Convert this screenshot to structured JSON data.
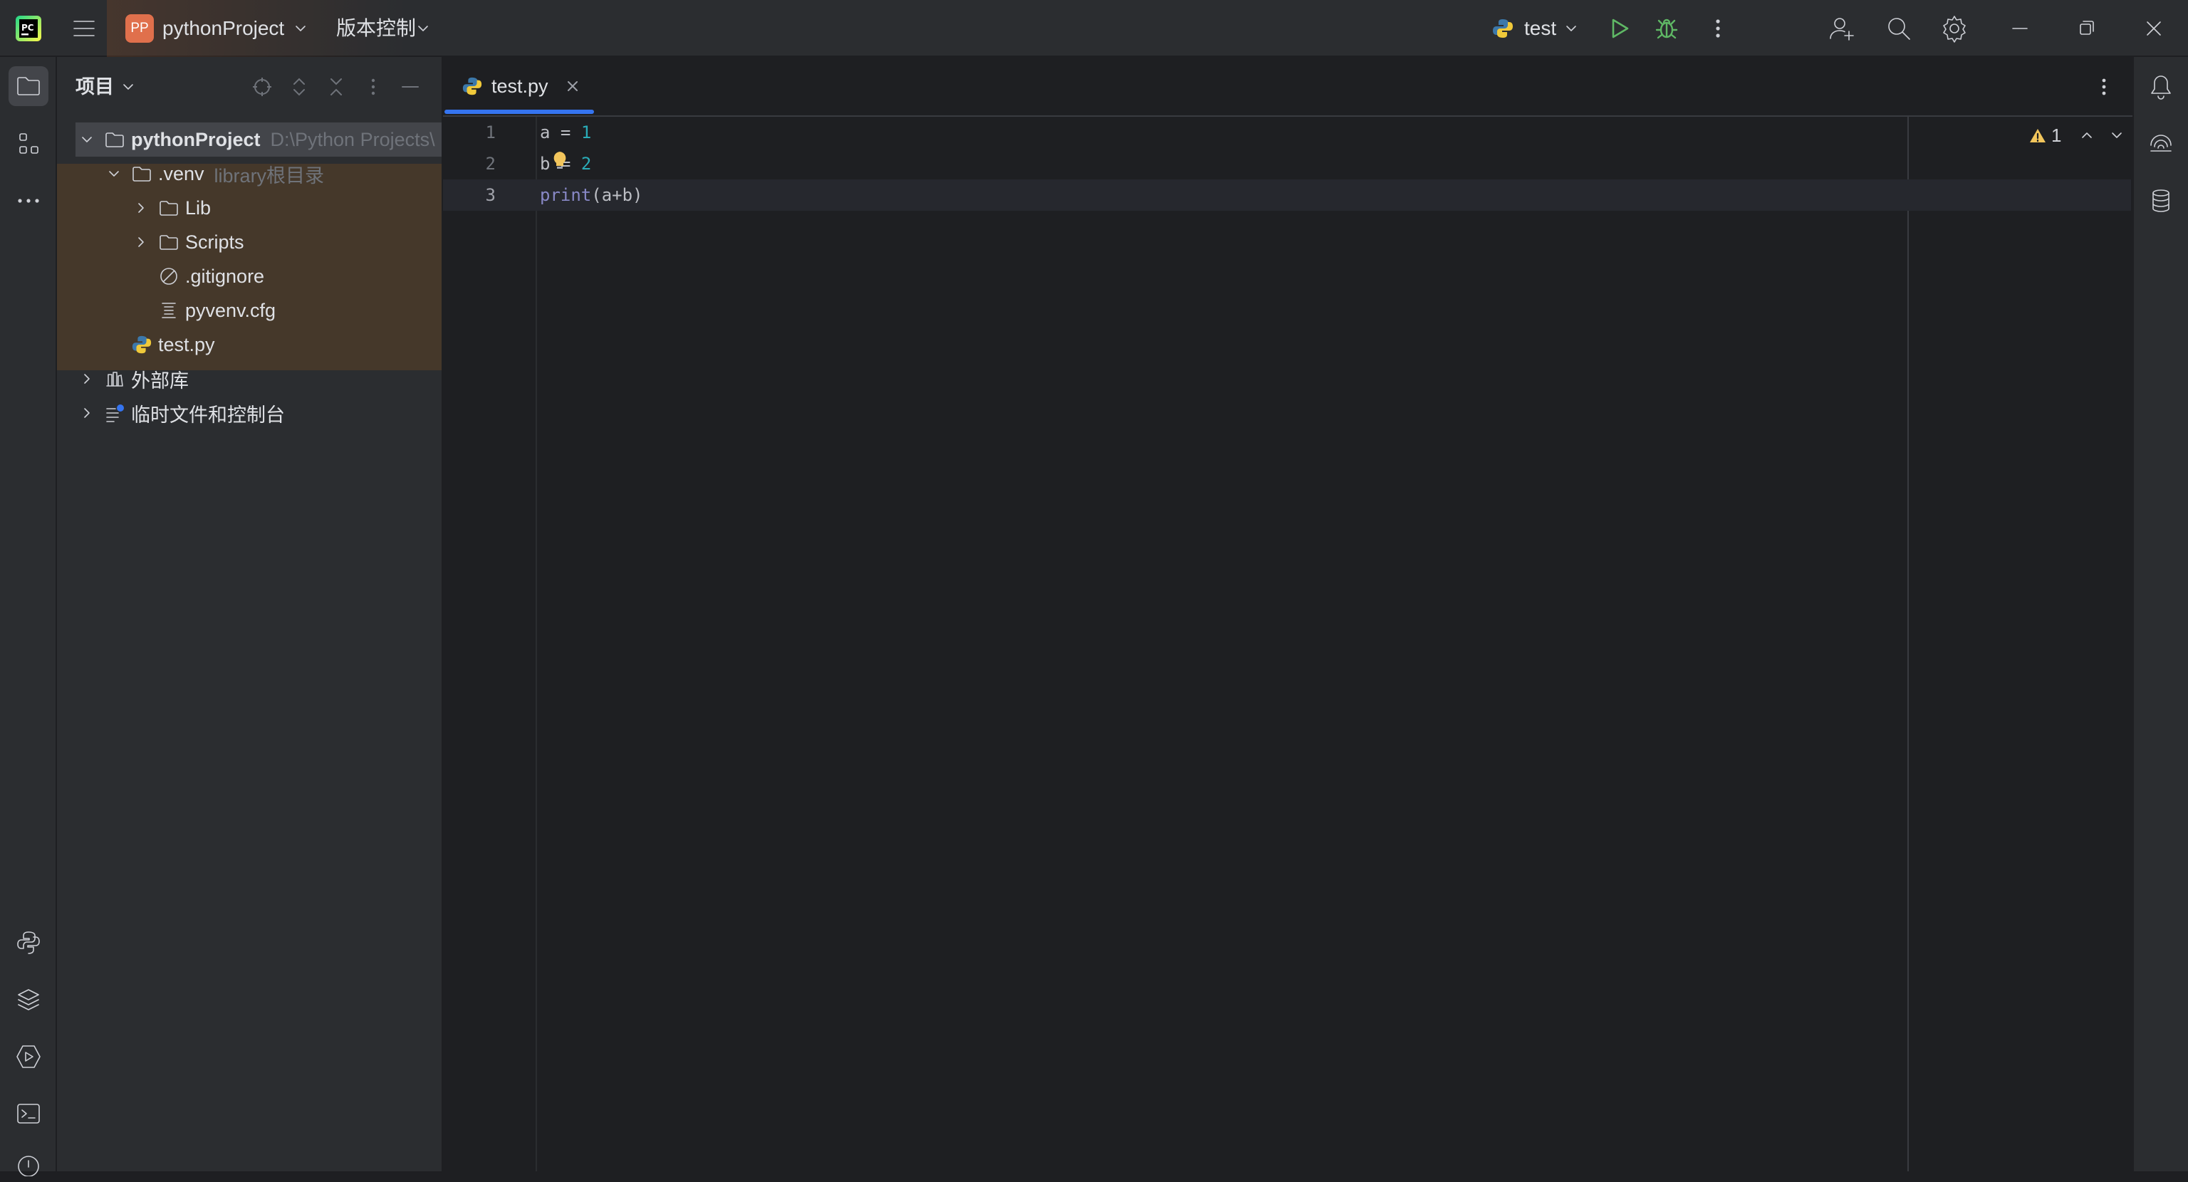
{
  "titlebar": {
    "app_icon": "pycharm-logo",
    "project_badge": "PP",
    "project_name": "pythonProject",
    "vcs_label": "版本控制",
    "run_config": "test"
  },
  "left_strip": {
    "top_icons": [
      "folder-icon",
      "structure-icon",
      "more-icon"
    ],
    "bottom_icons": [
      "python-console-icon",
      "layers-icon",
      "services-icon",
      "terminal-icon",
      "problems-icon"
    ]
  },
  "project_panel": {
    "title": "项目",
    "tree": [
      {
        "label": "pythonProject",
        "hint": "D:\\Python Projects\\",
        "icon": "folder-icon"
      },
      {
        "label": ".venv",
        "hint": "library根目录",
        "icon": "folder-icon"
      },
      {
        "label": "Lib",
        "icon": "folder-icon"
      },
      {
        "label": "Scripts",
        "icon": "folder-icon"
      },
      {
        "label": ".gitignore",
        "icon": "ignore-file-icon"
      },
      {
        "label": "pyvenv.cfg",
        "icon": "config-file-icon"
      },
      {
        "label": "test.py",
        "icon": "python-file-icon"
      },
      {
        "label": "外部库",
        "icon": "library-icon"
      },
      {
        "label": "临时文件和控制台",
        "icon": "scratches-icon"
      }
    ]
  },
  "editor": {
    "tab": {
      "label": "test.py"
    },
    "line_numbers": [
      "1",
      "2",
      "3"
    ],
    "lines": [
      {
        "a": "a",
        "op": " = ",
        "num": "1"
      },
      {
        "a": "b",
        "op": " = ",
        "num": "2"
      },
      {
        "fn": "print",
        "rest": "(a+b)"
      }
    ],
    "warning_count": "1"
  },
  "colors": {
    "accent": "#3574f0",
    "run_green": "#5fb865",
    "number": "#2aacb8",
    "builtin": "#8888c6",
    "venv_highlight": "#45382a"
  }
}
